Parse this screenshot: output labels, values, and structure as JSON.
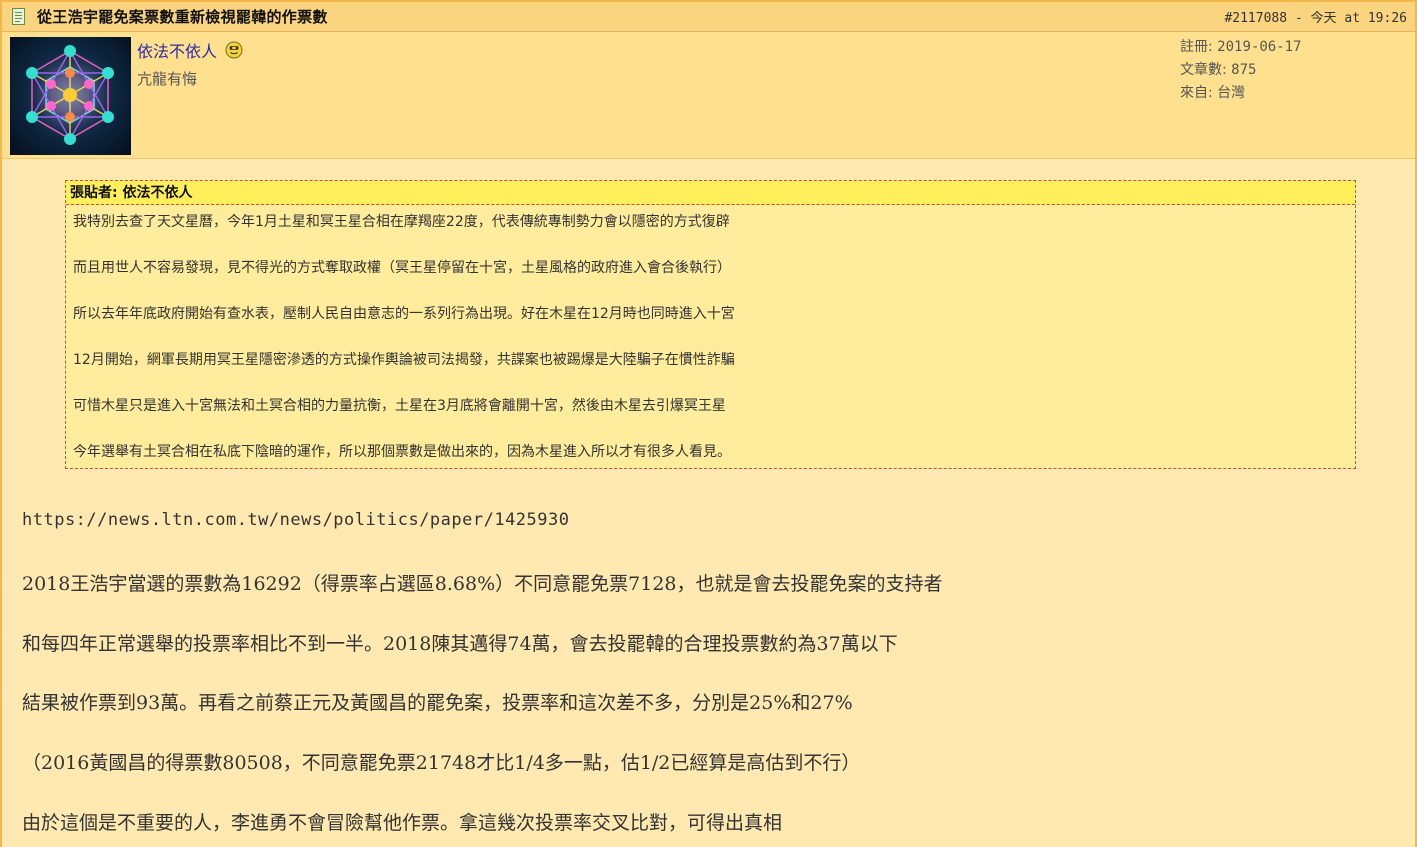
{
  "post": {
    "title": "從王浩宇罷免案票數重新檢視罷韓的作票數",
    "meta": "#2117088 - 今天 at 19:26"
  },
  "author": {
    "name": "依法不依人",
    "subtitle": "亢龍有悔",
    "stats": [
      {
        "label": "註冊: ",
        "value": "2019-06-17"
      },
      {
        "label": "文章數: ",
        "value": "875"
      },
      {
        "label": "來自: ",
        "value": "台灣"
      }
    ]
  },
  "quote": {
    "header": "張貼者: 依法不依人",
    "lines": [
      "我特別去查了天文星曆，今年1月土星和冥王星合相在摩羯座22度，代表傳統專制勢力會以隱密的方式復辟",
      "而且用世人不容易發現，見不得光的方式奪取政權（冥王星停留在十宮，土星風格的政府進入會合後執行）",
      "所以去年年底政府開始有查水表，壓制人民自由意志的一系列行為出現。好在木星在12月時也同時進入十宮",
      "12月開始，網軍長期用冥王星隱密滲透的方式操作輿論被司法揭發，共諜案也被踢爆是大陸騙子在慣性詐騙",
      "可惜木星只是進入十宮無法和土冥合相的力量抗衡，土星在3月底將會離開十宮，然後由木星去引爆冥王星",
      "今年選舉有土冥合相在私底下陰暗的運作，所以那個票數是做出來的，因為木星進入所以才有很多人看見。"
    ]
  },
  "body": {
    "url": "https://news.ltn.com.tw/news/politics/paper/1425930",
    "lines": [
      "2018王浩宇當選的票數為16292（得票率占選區8.68%）不同意罷免票7128，也就是會去投罷免案的支持者",
      "和每四年正常選舉的投票率相比不到一半。2018陳其邁得74萬，會去投罷韓的合理投票數約為37萬以下",
      "結果被作票到93萬。再看之前蔡正元及黃國昌的罷免案，投票率和這次差不多，分別是25%和27%",
      "（2016黃國昌的得票數80508，不同意罷免票21748才比1/4多一點，估1/2已經算是高估到不行）",
      "由於這個是不重要的人，李進勇不會冒險幫他作票。拿這幾次投票率交叉比對，可得出真相"
    ]
  },
  "icons": {
    "title": "document-icon",
    "author_status": "smiley-icon",
    "avatar": "sacred-geometry-avatar"
  },
  "colors": {
    "title_bar": "#fbd480",
    "author_bg": "#ffe08f",
    "page_bg": "#ffe9b0",
    "quote_header": "#ffef5a",
    "quote_border": "#c94d3a",
    "author_name": "#2a2aa6"
  }
}
